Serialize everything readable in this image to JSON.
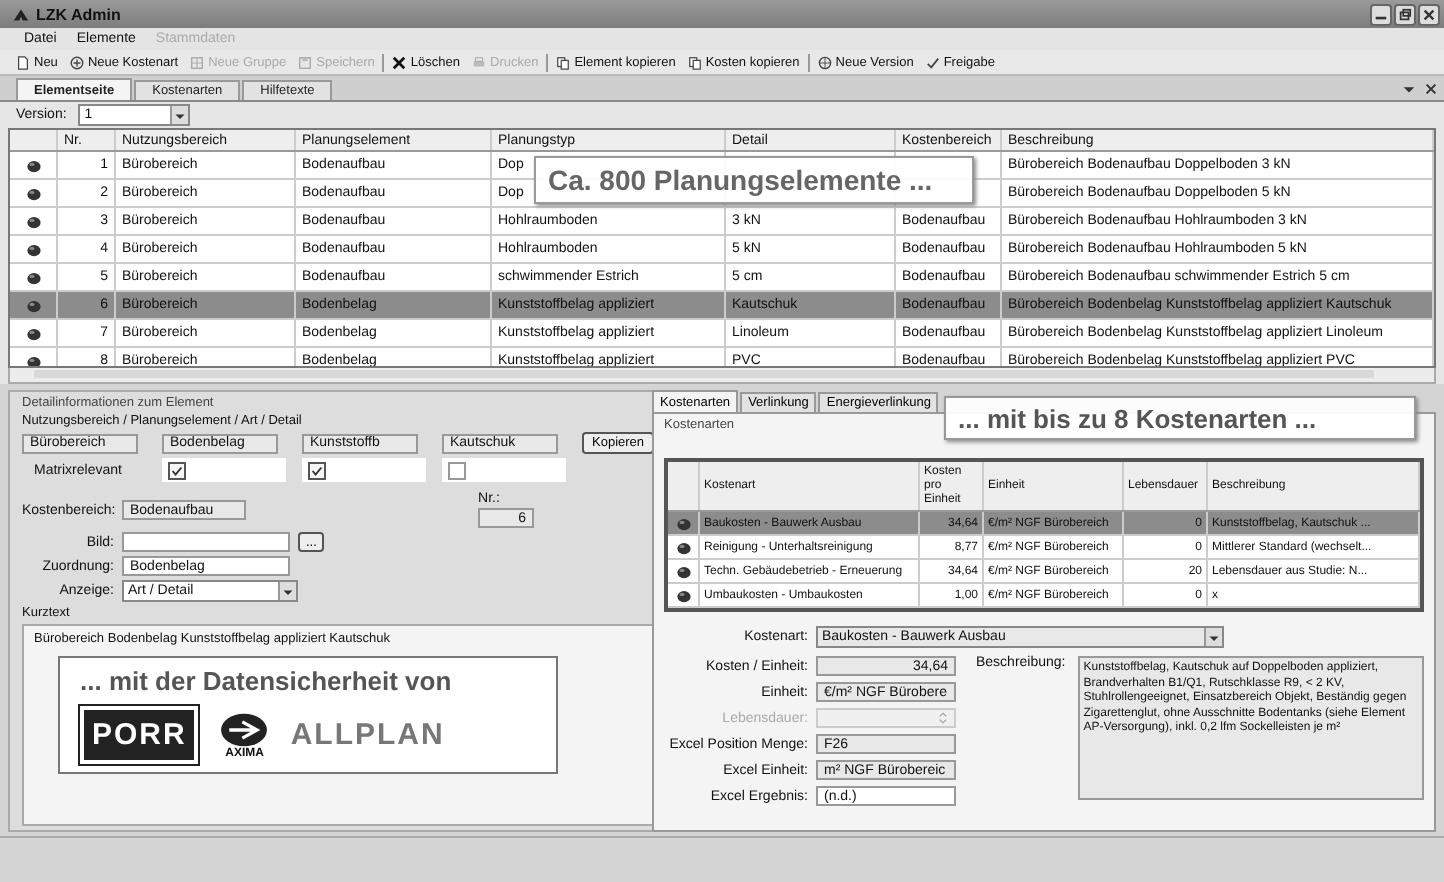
{
  "window": {
    "title": "LZK Admin"
  },
  "menu": [
    {
      "label": "Datei",
      "disabled": false
    },
    {
      "label": "Elemente",
      "disabled": false
    },
    {
      "label": "Stammdaten",
      "disabled": true
    }
  ],
  "toolbar": [
    {
      "label": "Neu",
      "disabled": false
    },
    {
      "label": "Neue Kostenart",
      "disabled": false
    },
    {
      "label": "Neue Gruppe",
      "disabled": true
    },
    {
      "label": "Speichern",
      "disabled": true
    },
    {
      "label": "Löschen",
      "disabled": false
    },
    {
      "label": "Drucken",
      "disabled": true
    },
    {
      "label": "Element kopieren",
      "disabled": false
    },
    {
      "label": "Kosten kopieren",
      "disabled": false
    },
    {
      "label": "Neue Version",
      "disabled": false
    },
    {
      "label": "Freigabe",
      "disabled": false
    }
  ],
  "tabs": [
    {
      "label": "Elementseite",
      "selected": true
    },
    {
      "label": "Kostenarten",
      "selected": false
    },
    {
      "label": "Hilfetexte",
      "selected": false
    }
  ],
  "version": {
    "label": "Version:",
    "value": "1"
  },
  "table": {
    "columns": [
      "Nr.",
      "Nutzungsbereich",
      "Planungselement",
      "Planungstyp",
      "Detail",
      "Kostenbereich",
      "Beschreibung"
    ],
    "rows": [
      {
        "nr": "1",
        "nutzungsbereich": "Bürobereich",
        "planungselement": "Bodenaufbau",
        "planungstyp": "Dop",
        "beschreibung": "Bürobereich Bodenaufbau Doppelboden 3 kN",
        "selected": false
      },
      {
        "nr": "2",
        "nutzungsbereich": "Bürobereich",
        "planungselement": "Bodenaufbau",
        "planungstyp": "Dop",
        "beschreibung": "Bürobereich Bodenaufbau Doppelboden 5 kN",
        "selected": false
      },
      {
        "nr": "3",
        "nutzungsbereich": "Bürobereich",
        "planungselement": "Bodenaufbau",
        "planungstyp": "Hohlraumboden",
        "detail": "3 kN",
        "kostenbereich": "Bodenaufbau",
        "beschreibung": "Bürobereich Bodenaufbau Hohlraumboden 3 kN",
        "selected": false
      },
      {
        "nr": "4",
        "nutzungsbereich": "Bürobereich",
        "planungselement": "Bodenaufbau",
        "planungstyp": "Hohlraumboden",
        "detail": "5 kN",
        "kostenbereich": "Bodenaufbau",
        "beschreibung": "Bürobereich Bodenaufbau Hohlraumboden 5 kN",
        "selected": false
      },
      {
        "nr": "5",
        "nutzungsbereich": "Bürobereich",
        "planungselement": "Bodenaufbau",
        "planungstyp": "schwimmender Estrich",
        "detail": "5 cm",
        "kostenbereich": "Bodenaufbau",
        "beschreibung": "Bürobereich Bodenaufbau schwimmender Estrich 5 cm",
        "selected": false
      },
      {
        "nr": "6",
        "nutzungsbereich": "Bürobereich",
        "planungselement": "Bodenbelag",
        "planungstyp": "Kunststoffbelag appliziert",
        "detail": "Kautschuk",
        "kostenbereich": "Bodenaufbau",
        "beschreibung": "Bürobereich Bodenbelag Kunststoffbelag appliziert Kautschuk",
        "selected": true
      },
      {
        "nr": "7",
        "nutzungsbereich": "Bürobereich",
        "planungselement": "Bodenbelag",
        "planungstyp": "Kunststoffbelag appliziert",
        "detail": "Linoleum",
        "kostenbereich": "Bodenaufbau",
        "beschreibung": "Bürobereich Bodenbelag Kunststoffbelag appliziert Linoleum",
        "selected": false
      },
      {
        "nr": "8",
        "nutzungsbereich": "Bürobereich",
        "planungselement": "Bodenbelag",
        "planungstyp": "Kunststoffbelag appliziert",
        "detail": "PVC",
        "kostenbereich": "Bodenaufbau",
        "beschreibung": "Bürobereich Bodenbelag Kunststoffbelag appliziert PVC",
        "selected": false
      }
    ]
  },
  "callout_elements": "Ca. 800 Planungselemente ...",
  "details": {
    "title": "Detailinformationen zum Element",
    "path_label": "Nutzungsbereich / Planungselement / Art / Detail",
    "path_fields": [
      {
        "value": "Bürobereich"
      },
      {
        "value": "Bodenbelag",
        "checked": true
      },
      {
        "value": "Kunststoffb",
        "checked": true
      },
      {
        "value": "Kautschuk",
        "checked": false
      }
    ],
    "copy_button": "Kopieren",
    "matrix_label": "Matrixrelevant",
    "kostenbereich_label": "Kostenbereich:",
    "kostenbereich": "Bodenaufbau",
    "nr_label": "Nr.:",
    "nr": "6",
    "bild_label": "Bild:",
    "browse_button": "...",
    "zuordnung_label": "Zuordnung:",
    "zuordnung": "Bodenbelag",
    "anzeige_label": "Anzeige:",
    "anzeige": "Art / Detail",
    "kurztext_label": "Kurztext",
    "kurztext": "Bürobereich Bodenbelag Kunststoffbelag appliziert Kautschuk"
  },
  "promo": {
    "headline": "... mit der Datensicherheit von",
    "logos": [
      "PORR",
      "AXIMA",
      "ALLPLAN"
    ]
  },
  "cost_tabs": [
    {
      "label": "Kostenarten",
      "selected": true
    },
    {
      "label": "Verlinkung",
      "selected": false
    },
    {
      "label": "Energieverlinkung",
      "selected": false
    }
  ],
  "callout_costs": "... mit bis zu 8 Kostenarten ...",
  "costs": {
    "title": "Kostenarten",
    "columns": [
      "Kostenart",
      "Kosten pro Einheit",
      "Einheit",
      "Lebensdauer",
      "Beschreibung"
    ],
    "rows": [
      {
        "kostenart": "Baukosten - Bauwerk Ausbau",
        "kosten": "34,64",
        "einheit": "€/m² NGF Bürobereich",
        "lebensdauer": "0",
        "beschreibung": "Kunststoffbelag, Kautschuk ...",
        "selected": true
      },
      {
        "kostenart": "Reinigung - Unterhaltsreinigung",
        "kosten": "8,77",
        "einheit": "€/m² NGF Bürobereich",
        "lebensdauer": "0",
        "beschreibung": "Mittlerer Standard (wechselt...",
        "selected": false
      },
      {
        "kostenart": "Techn. Gebäudebetrieb - Erneuerung",
        "kosten": "34,64",
        "einheit": "€/m² NGF Bürobereich",
        "lebensdauer": "20",
        "beschreibung": "Lebensdauer aus Studie: N...",
        "selected": false
      },
      {
        "kostenart": "Umbaukosten - Umbaukosten",
        "kosten": "1,00",
        "einheit": "€/m² NGF Bürobereich",
        "lebensdauer": "0",
        "beschreibung": "x",
        "selected": false
      }
    ]
  },
  "cost_form": {
    "kostenart_label": "Kostenart:",
    "kostenart": "Baukosten - Bauwerk Ausbau",
    "fields": [
      {
        "label": "Kosten / Einheit:",
        "value": "34,64",
        "kind": "number",
        "disabled": false
      },
      {
        "label": "Einheit:",
        "value": "€/m² NGF Bürobere",
        "kind": "text",
        "disabled": false
      },
      {
        "label": "Lebensdauer:",
        "kind": "spinner",
        "disabled": true
      },
      {
        "label": "Excel Position Menge:",
        "value": "F26",
        "kind": "text",
        "disabled": false
      },
      {
        "label": "Excel Einheit:",
        "value": "m² NGF Bürobereic",
        "kind": "text",
        "disabled": false
      },
      {
        "label": "Excel Ergebnis:",
        "value": "(n.d.)",
        "kind": "input",
        "disabled": false
      }
    ],
    "beschreibung_label": "Beschreibung:",
    "beschreibung": "Kunststoffbelag, Kautschuk auf Doppelboden appliziert, Brandverhalten B1/Q1, Rutschklasse R9, < 2 KV, Stuhlrollengeeignet, Einsatzbereich Objekt, Beständig gegen Zigarettenglut, ohne Ausschnitte Bodentanks (siehe Element AP-Versorgung), inkl. 0,2 lfm Sockelleisten je m²"
  }
}
